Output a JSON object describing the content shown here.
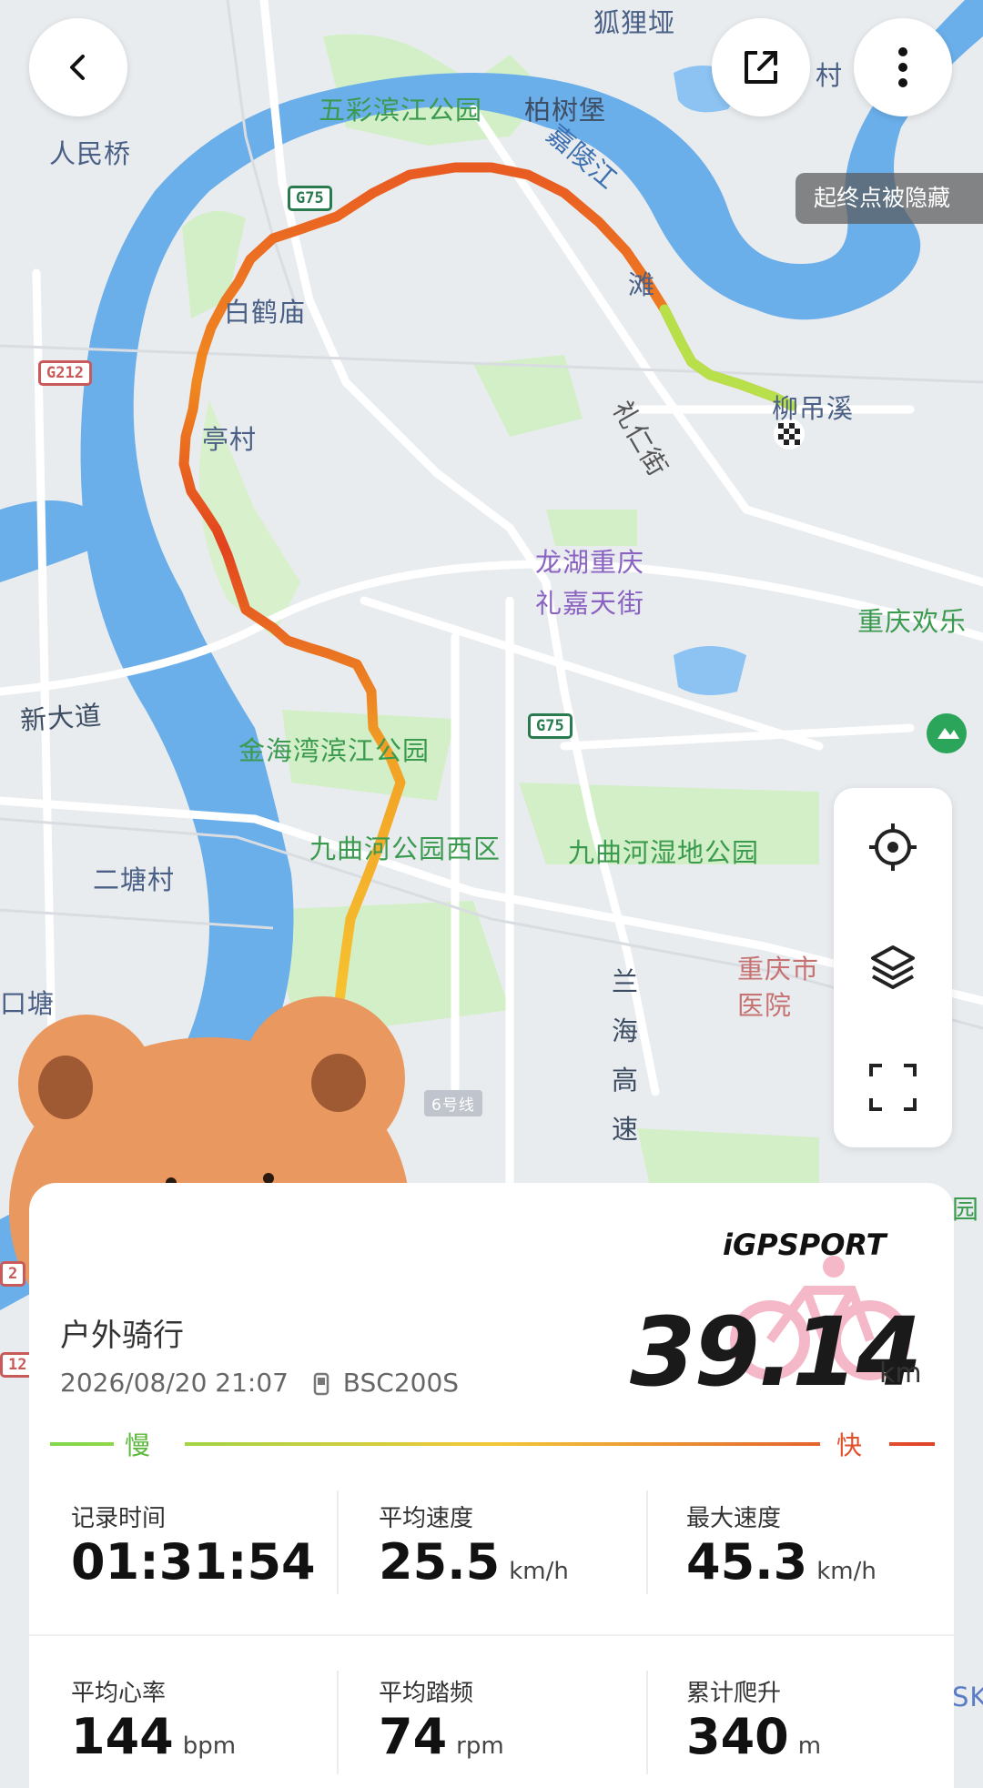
{
  "map": {
    "labels": {
      "hulipo": "狐狸垭",
      "cun_top": "村",
      "renminqiao": "人民桥",
      "wucai_park": "五彩滨江公园",
      "baishubao": "柏树堡",
      "jialingjiang": "嘉陵江",
      "baihemiao": "白鹤庙",
      "tan": "滩",
      "lirenjie": "礼仁街",
      "liudiaoxi": "柳吊溪",
      "yangtingcun": "亭村",
      "longhu_1": "龙湖重庆",
      "longhu_2": "礼嘉天街",
      "chongqing_huanle": "重庆欢乐",
      "xindadao": "新大道",
      "jinhaiwan": "金海湾滨江公园",
      "jiuqu_west": "九曲河公园西区",
      "jiuqu_wetland": "九曲河湿地公园",
      "ertangcun": "二塘村",
      "kou_tang": "口塘",
      "lanhai": "兰海高速",
      "hospital_1": "重庆市",
      "hospital_2": "医院",
      "line6": "6号线",
      "yuan": "园",
      "sk": "SK"
    },
    "shields": {
      "g75_top": "G75",
      "g75_mid": "G75",
      "g212": "G212",
      "n2_a": "2",
      "n12": "12"
    }
  },
  "tooltip": "起终点被隐藏",
  "card": {
    "brand": "iGPSPORT",
    "title": "户外骑行",
    "datetime": "2026/08/20 21:07",
    "device": "BSC200S",
    "distance": "39.14",
    "distance_unit": "km",
    "slow_label": "慢",
    "fast_label": "快",
    "stats": [
      {
        "label": "记录时间",
        "value": "01:31:54",
        "unit": ""
      },
      {
        "label": "平均速度",
        "value": "25.5",
        "unit": "km/h"
      },
      {
        "label": "最大速度",
        "value": "45.3",
        "unit": "km/h"
      },
      {
        "label": "平均心率",
        "value": "144",
        "unit": "bpm"
      },
      {
        "label": "平均踏频",
        "value": "74",
        "unit": "rpm"
      },
      {
        "label": "累计爬升",
        "value": "340",
        "unit": "m"
      }
    ]
  },
  "colors": {
    "river": "#5aa5e6",
    "park": "#cfeec4",
    "accent_green": "#3a9a4e",
    "route_slow": "#7fd94a",
    "route_fast": "#e0402a"
  },
  "icons": [
    "back-icon",
    "share-icon",
    "more-icon",
    "locate-icon",
    "layers-icon",
    "fullscreen-icon",
    "bike-icon",
    "device-icon",
    "finish-flag-icon"
  ]
}
